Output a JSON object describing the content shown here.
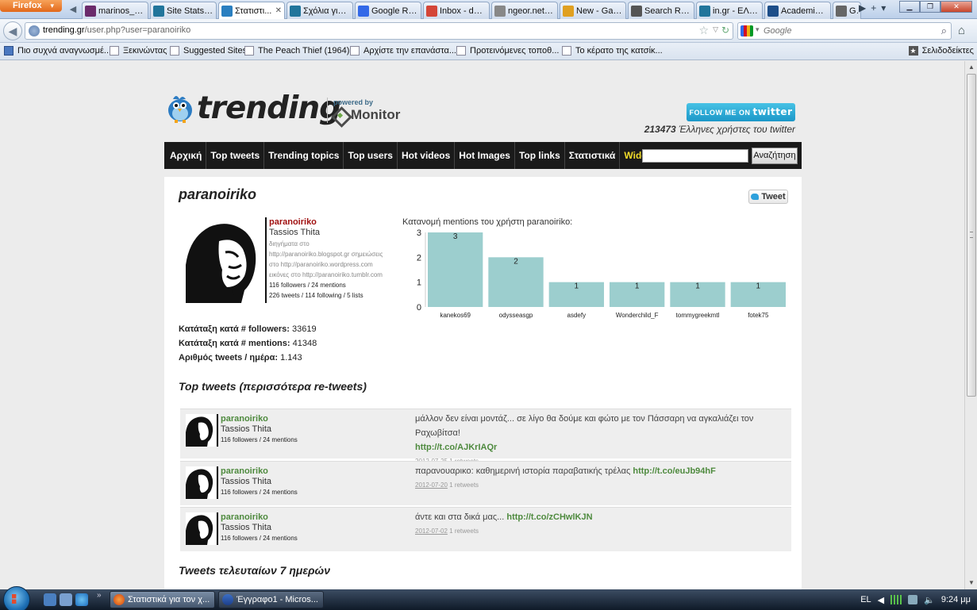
{
  "browser": {
    "app_button": "Firefox",
    "tabs": [
      {
        "label": "marinos_sar...",
        "icon": "mail-icon",
        "color": "#6b2b6b"
      },
      {
        "label": "Site Stats ‹ o...",
        "icon": "wordpress-icon",
        "color": "#21759b"
      },
      {
        "label": "Στατιστι...",
        "icon": "twitter-bird-icon",
        "color": "#2a7fc0",
        "active": true
      },
      {
        "label": "Σχόλια για ...",
        "icon": "wordpress-icon",
        "color": "#21759b"
      },
      {
        "label": "Google Rea...",
        "icon": "google-icon",
        "color": "#3369e8"
      },
      {
        "label": "Inbox - dyti...",
        "icon": "gmail-icon",
        "color": "#d44638"
      },
      {
        "label": "ngeor.net | ...",
        "icon": "page-icon",
        "color": "#888888"
      },
      {
        "label": "New - Gath...",
        "icon": "lightbulb-icon",
        "color": "#e0a020"
      },
      {
        "label": "Search Resu...",
        "icon": "search-result-icon",
        "color": "#555555"
      },
      {
        "label": "in.gr - ΕΛΛ...",
        "icon": "wordpress-icon",
        "color": "#21759b"
      },
      {
        "label": "Academia.e...",
        "icon": "academia-icon",
        "color": "#1d4e89"
      },
      {
        "label": "Ga",
        "icon": "wikipedia-icon",
        "color": "#666666"
      }
    ],
    "url_domain": "trending.gr",
    "url_path": "/user.php?user=paranoiriko",
    "search_placeholder": "Google",
    "bookmarks": [
      {
        "label": "Πιο συχνά αναγνωσμέ..."
      },
      {
        "label": "Ξεκινώντας"
      },
      {
        "label": "Suggested Sites"
      },
      {
        "label": "The Peach Thief (1964)..."
      },
      {
        "label": "Αρχίστε την επανάστα..."
      },
      {
        "label": "Προτεινόμενες τοποθ..."
      },
      {
        "label": "Το κέρατο της κατσίκ..."
      }
    ],
    "bookmarks_right": "Σελιδοδείκτες"
  },
  "site": {
    "logo_text": "trending",
    "powered_by": "powered by",
    "monitor_text": "Monitor",
    "follow_button": "FOLLOW ME ON",
    "follow_brand": "twitter",
    "users_count": "213473",
    "users_text": " Έλληνες χρήστες του twitter",
    "nav": [
      "Αρχική",
      "Top tweets",
      "Trending topics",
      "Top users",
      "Hot videos",
      "Hot Images",
      "Top links",
      "Στατιστικά"
    ],
    "nav_widget": "Widget",
    "search_button": "Αναζήτηση"
  },
  "profile": {
    "title": "paranoiriko",
    "tweet_button": "Tweet",
    "username": "paranoiriko",
    "realname": "Tassios Thita",
    "bio": [
      {
        "pre": "διηγήματα στο",
        "link": ""
      },
      {
        "pre": "",
        "link": "http://paranoiriko.blogspot.gr",
        "post": " σημειώσεις"
      },
      {
        "pre": "στο ",
        "link": "http://paranoiriko.wordpress.com",
        "post": ""
      },
      {
        "pre": "εικόνες στο ",
        "link": "http://paranoiriko.tumblr.com",
        "post": ""
      }
    ],
    "stats_line1": "116 followers / 24 mentions",
    "stats_line2": "226 tweets / 114 following / 5 lists",
    "rank_followers_label": "Κατάταξη κατά # followers:",
    "rank_followers_value": " 33619",
    "rank_mentions_label": "Κατάταξη κατά # mentions:",
    "rank_mentions_value": " 41348",
    "tweets_per_day_label": "Αριθμός tweets / ημέρα:",
    "tweets_per_day_value": " 1.143"
  },
  "chart_data": {
    "type": "bar",
    "title": "Κατανομή mentions του χρήστη paranoiriko:",
    "categories": [
      "kanekos69",
      "odysseasgp",
      "asdefy",
      "Wonderchild_F",
      "tommygreekmtl",
      "fotek75"
    ],
    "values": [
      3,
      2,
      1,
      1,
      1,
      1
    ],
    "ylim": [
      0,
      3
    ],
    "yticks": [
      0,
      1,
      2,
      3
    ],
    "bar_color": "#9ccece",
    "grid": false
  },
  "top_tweets": {
    "title": "Top tweets (περισσότερα re-tweets)",
    "items": [
      {
        "user": "paranoiriko",
        "realname": "Tassios Thita",
        "stats": "116 followers / 24 mentions",
        "text": "μάλλον δεν είναι μοντάζ... σε λίγο θα δούμε και φώτο με τον Πάσσαρη να αγκαλιάζει τον Ραχωβίτσα!",
        "link": "http://t.co/AJKrIAQr",
        "date": "2012-07-25",
        "retweets": " 1 retweets"
      },
      {
        "user": "paranoiriko",
        "realname": "Tassios Thita",
        "stats": "116 followers / 24 mentions",
        "text": "παρανουαρικο: καθημερινή ιστορία παραβατικής τρέλας ",
        "link": "http://t.co/euJb94hF",
        "date": "2012-07-20",
        "retweets": " 1 retweets"
      },
      {
        "user": "paranoiriko",
        "realname": "Tassios Thita",
        "stats": "116 followers / 24 mentions",
        "text": "άντε και στα δικά μας... ",
        "link": "http://t.co/zCHwlKJN",
        "date": "2012-07-02",
        "retweets": " 1 retweets"
      }
    ]
  },
  "recent": {
    "title": "Tweets τελευταίων 7 ημερών"
  },
  "taskbar": {
    "tasks": [
      {
        "label": "Στατιστικά για τον χ...",
        "active": true
      },
      {
        "label": "Έγγραφο1 - Micros...",
        "active": false
      }
    ],
    "lang": "EL",
    "time": "9:24 μμ"
  }
}
